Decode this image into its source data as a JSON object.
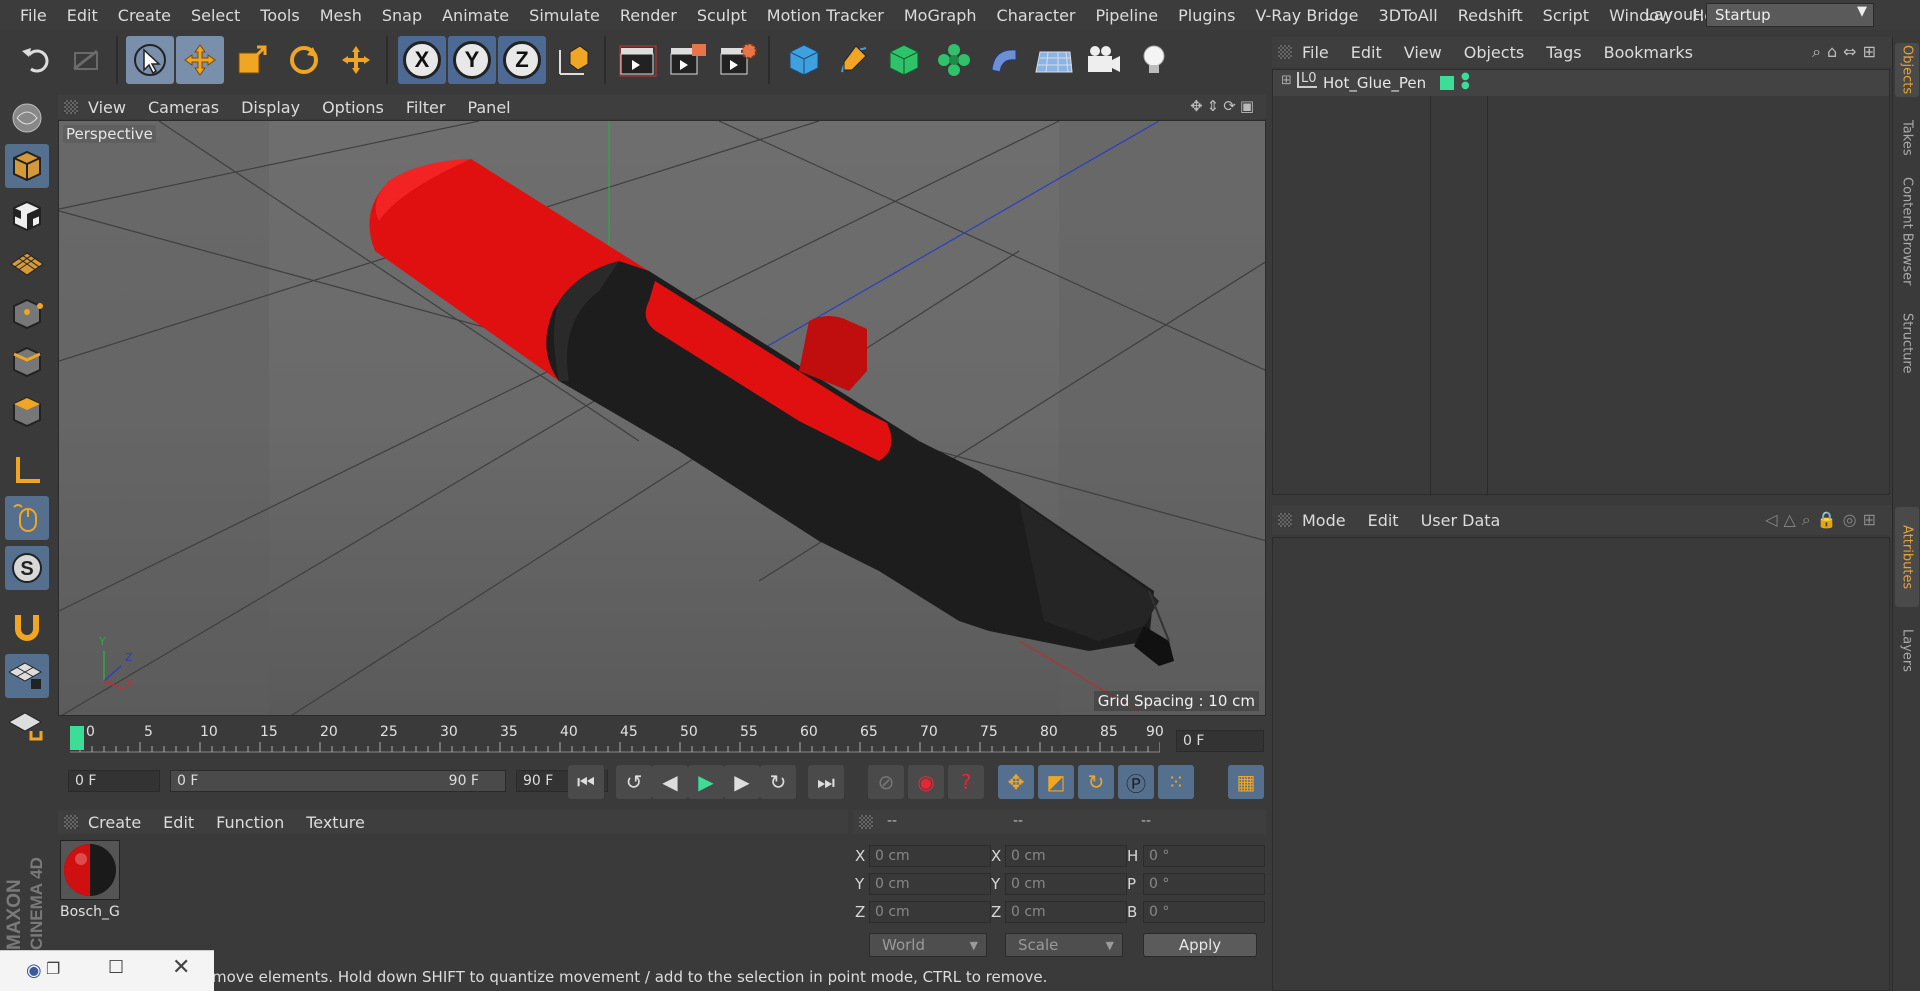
{
  "menubar": {
    "items": [
      "File",
      "Edit",
      "Create",
      "Select",
      "Tools",
      "Mesh",
      "Snap",
      "Animate",
      "Simulate",
      "Render",
      "Sculpt",
      "Motion Tracker",
      "MoGraph",
      "Character",
      "Pipeline",
      "Plugins",
      "V-Ray Bridge",
      "3DToAll",
      "Redshift",
      "Script",
      "Window",
      "Help"
    ],
    "layout_label": "Layout:",
    "layout_value": "Startup"
  },
  "toolbar": {
    "axis_x": "X",
    "axis_y": "Y",
    "axis_z": "Z"
  },
  "viewport": {
    "menu": [
      "View",
      "Cameras",
      "Display",
      "Options",
      "Filter",
      "Panel"
    ],
    "label": "Perspective",
    "grid_spacing": "Grid Spacing : 10 cm",
    "axis_y": "Y",
    "axis_z": "Z",
    "axis_x": "X"
  },
  "timeline": {
    "ticks": [
      "0",
      "5",
      "10",
      "15",
      "20",
      "25",
      "30",
      "35",
      "40",
      "45",
      "50",
      "55",
      "60",
      "65",
      "70",
      "75",
      "80",
      "85",
      "90"
    ],
    "current_frame": "0 F"
  },
  "transport": {
    "start_field": "0 F",
    "range_start": "0 F",
    "range_end": "90 F",
    "end_field": "90 F"
  },
  "materials": {
    "menu": [
      "Create",
      "Edit",
      "Function",
      "Texture"
    ],
    "items": [
      {
        "name": "Bosch_G"
      }
    ]
  },
  "coordinates": {
    "headers": [
      "--",
      "--",
      "--"
    ],
    "rows": [
      {
        "l1": "X",
        "v1": "0 cm",
        "l2": "X",
        "v2": "0 cm",
        "l3": "H",
        "v3": "0 °"
      },
      {
        "l1": "Y",
        "v1": "0 cm",
        "l2": "Y",
        "v2": "0 cm",
        "l3": "P",
        "v3": "0 °"
      },
      {
        "l1": "Z",
        "v1": "0 cm",
        "l2": "Z",
        "v2": "0 cm",
        "l3": "B",
        "v3": "0 °"
      }
    ],
    "mode_world": "World",
    "mode_scale": "Scale",
    "apply_label": "Apply"
  },
  "status": {
    "text": "move elements. Hold down SHIFT to quantize movement / add to the selection in point mode, CTRL to remove."
  },
  "object_manager": {
    "menu": [
      "File",
      "Edit",
      "View",
      "Objects",
      "Tags",
      "Bookmarks"
    ],
    "objects": [
      {
        "name": "Hot_Glue_Pen",
        "layer_icon": "L0"
      }
    ]
  },
  "attribute_manager": {
    "menu": [
      "Mode",
      "Edit",
      "User Data"
    ]
  },
  "side_tabs": [
    "Objects",
    "Takes",
    "Content Browser",
    "Structure",
    "Attributes",
    "Layers"
  ],
  "logo": {
    "brand": "MAXON",
    "product": "CINEMA 4D"
  },
  "colors": {
    "accent_orange": "#e6a23a",
    "selection_blue": "#7a8fab",
    "pen_red": "#e01010",
    "pen_black": "#1b1b1b",
    "status_green": "#3ddc97"
  }
}
